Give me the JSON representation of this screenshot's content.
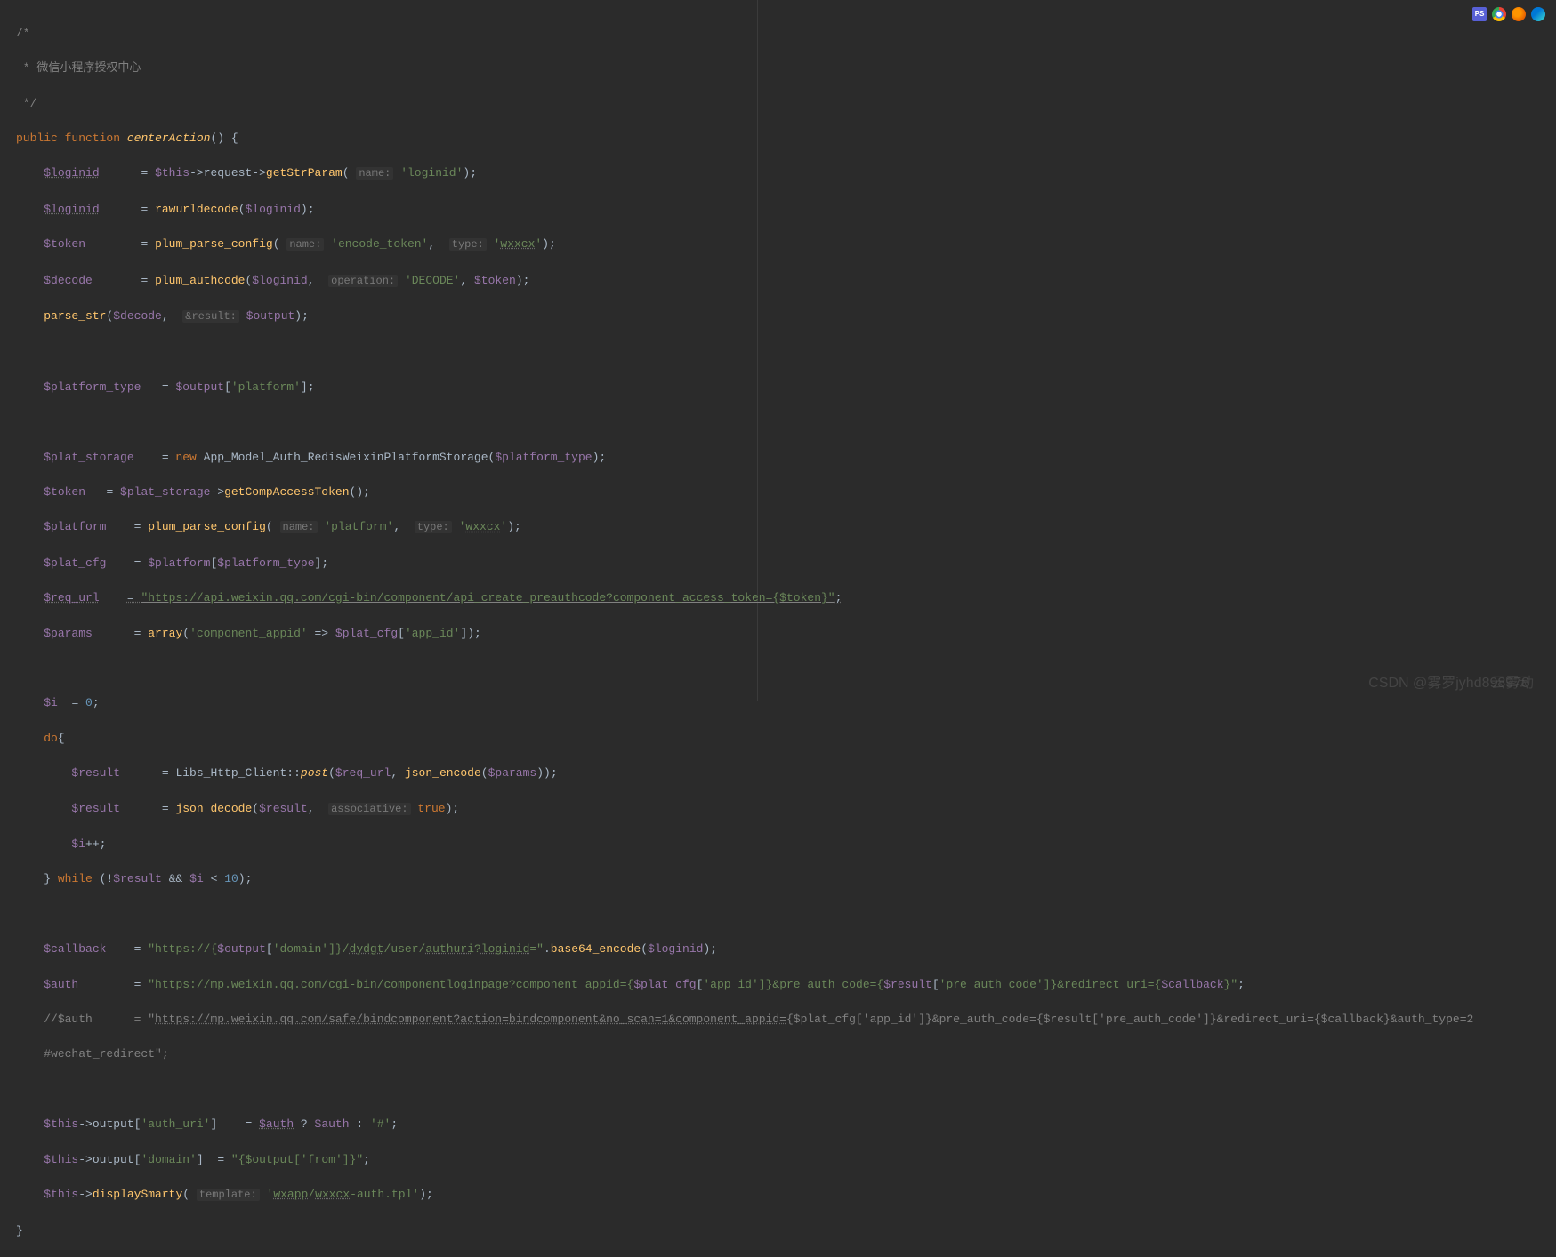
{
  "comment": {
    "l1": "/*",
    "l2": " * 微信小程序授权中心",
    "l3": " */"
  },
  "kw": {
    "public": "public",
    "function": "function",
    "new": "new",
    "do": "do",
    "while": "while",
    "this": "$this",
    "true": "true"
  },
  "fn": {
    "name": "centerAction"
  },
  "sig": {
    "open": "() {",
    "close": "}"
  },
  "vars": {
    "loginid": "$loginid",
    "token": "$token",
    "decode": "$decode",
    "output": "$output",
    "platform_type": "$platform_type",
    "plat_storage": "$plat_storage",
    "platform": "$platform",
    "plat_cfg": "$plat_cfg",
    "req_url": "$req_url",
    "params": "$params",
    "i": "$i",
    "result": "$result",
    "callback": "$callback",
    "auth": "$auth"
  },
  "methods": {
    "request": "request",
    "getStrParam": "getStrParam",
    "getCompAccessToken": "getCompAccessToken",
    "displaySmarty": "displaySmarty",
    "output_prop": "output",
    "post": "post"
  },
  "calls": {
    "rawurldecode": "rawurldecode",
    "plum_parse_config": "plum_parse_config",
    "plum_authcode": "plum_authcode",
    "parse_str": "parse_str",
    "json_encode": "json_encode",
    "json_decode": "json_decode",
    "array": "array",
    "base64_encode": "base64_encode"
  },
  "hints": {
    "name": "name:",
    "type": "type:",
    "operation": "operation:",
    "result": "&result:",
    "associative": "associative:",
    "template": "template:"
  },
  "strings": {
    "loginid": "'loginid'",
    "encode_token": "'encode_token'",
    "wxxcx": "'wxxcx'",
    "DECODE": "'DECODE'",
    "platform_key": "'platform'",
    "platform": "'platform'",
    "component_appid": "'component_appid'",
    "app_id": "'app_id'",
    "req_url": "\"https://api.weixin.qq.com/cgi-bin/component/api_create_preauthcode?component_access_token={$token}\"",
    "cb_p1": "\"https://{",
    "cb_domain": "'domain'",
    "cb_p2": "]}/",
    "cb_p3": "dydgt",
    "cb_p4": "/user/",
    "cb_p5": "authuri",
    "cb_p6": "?",
    "cb_p7": "loginid",
    "cb_p8": "=\"",
    "auth_p1": "\"https://mp.weixin.qq.com/cgi-bin/componentloginpage?component_appid={",
    "auth_p2": "]}&pre_auth_code={",
    "pre_auth_code": "'pre_auth_code'",
    "auth_p3": "]}&redirect_uri={",
    "auth_p4": "}\"",
    "cmt_auth_pre": "//$auth      = \"",
    "cmt_auth_url": "https://mp.weixin.qq.com/safe/bindcomponent?action=bindcomponent&no_scan=1&component_appid=",
    "cmt_auth_post1": "{$plat_cfg['app_id']}&pre_auth_code={$result['pre_auth_code']}&redirect_uri={$callback}&auth_type=2",
    "cmt_wechat": "#wechat_redirect\";",
    "auth_uri": "'auth_uri'",
    "hash": "'#'",
    "domain2": "'domain'",
    "from_out": "\"{$output['from']}\"",
    "tpl_p1": "'",
    "tpl_p2": "wxapp",
    "tpl_p3": "/",
    "tpl_p4": "wxxcx",
    "tpl_p5": "-auth.tpl'"
  },
  "classes": {
    "redis_storage": "App_Model_Auth_RedisWeixinPlatformStorage",
    "http_client": "Libs_Http_Client"
  },
  "nums": {
    "zero": "0",
    "ten": "10"
  },
  "ops": {
    "eq": "   = ",
    "eq2": "  = ",
    "eq3": " = ",
    "arrow": "->",
    "scope": "::",
    "semi": ";",
    "lparen": "(",
    "rparen": ")",
    "lbrack": "[",
    "rbrack": "]",
    "lbrace": "{",
    "rbrace": "}",
    "comma": ", ",
    "dot": ".",
    "fat_arrow": " => ",
    "plusplus": "++",
    "not": "!",
    "and": "&&",
    "lt": "<",
    "tern_q": " ? ",
    "tern_c": " : "
  },
  "watermark1": "CSDN @雾罗jyhd898978",
  "watermark2": "云雾动",
  "icons": {
    "ps": "PS"
  }
}
